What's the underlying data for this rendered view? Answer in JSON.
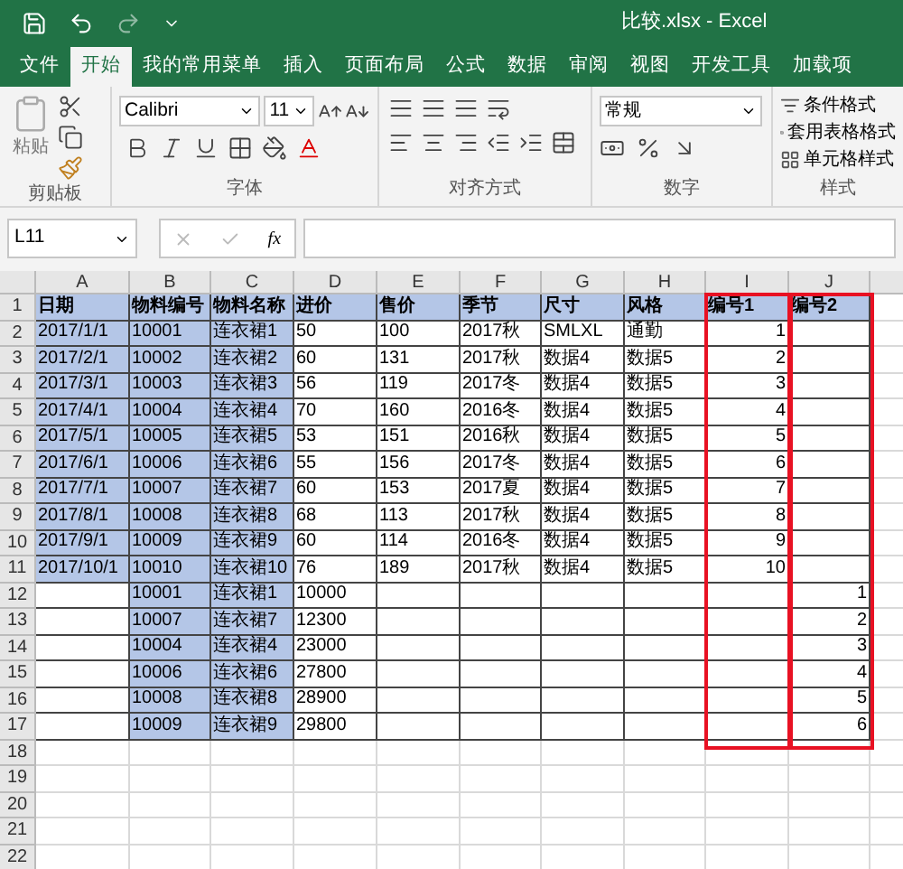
{
  "window": {
    "title": "比较.xlsx  -  Excel"
  },
  "tabs": [
    {
      "label": "文件",
      "selected": false
    },
    {
      "label": "开始",
      "selected": true
    },
    {
      "label": "我的常用菜单",
      "selected": false
    },
    {
      "label": "插入",
      "selected": false
    },
    {
      "label": "页面布局",
      "selected": false
    },
    {
      "label": "公式",
      "selected": false
    },
    {
      "label": "数据",
      "selected": false
    },
    {
      "label": "审阅",
      "selected": false
    },
    {
      "label": "视图",
      "selected": false
    },
    {
      "label": "开发工具",
      "selected": false
    },
    {
      "label": "加载项",
      "selected": false
    }
  ],
  "ribbon": {
    "paste_label": "粘贴",
    "font_name": "Calibri",
    "font_size": "11",
    "number_format": "常规",
    "styles": [
      "条件格式",
      "套用表格格式",
      "单元格样式"
    ],
    "groups": [
      "剪贴板",
      "字体",
      "对齐方式",
      "数字",
      "样式"
    ]
  },
  "formula_bar": {
    "name_box": "L11",
    "fx": "fx"
  },
  "columns": [
    {
      "label": "A",
      "framed": false
    },
    {
      "label": "B",
      "framed": false
    },
    {
      "label": "C",
      "framed": false
    },
    {
      "label": "D",
      "framed": false
    },
    {
      "label": "E",
      "framed": false
    },
    {
      "label": "F",
      "framed": false
    },
    {
      "label": "G",
      "framed": false
    },
    {
      "label": "H",
      "framed": false
    },
    {
      "label": "I",
      "framed": true
    },
    {
      "label": "J",
      "framed": true
    }
  ],
  "rows": [
    {
      "number": "1",
      "bold": true,
      "cells": [
        {
          "text": "日期",
          "highlighted": true
        },
        {
          "text": "物料编号",
          "highlighted": true
        },
        {
          "text": "物料名称",
          "highlighted": true
        },
        {
          "text": "进价",
          "highlighted": true
        },
        {
          "text": "售价",
          "highlighted": true
        },
        {
          "text": "季节",
          "highlighted": true
        },
        {
          "text": "尺寸",
          "highlighted": true
        },
        {
          "text": "风格",
          "highlighted": true
        },
        {
          "text": "编号1",
          "highlighted": true
        },
        {
          "text": "编号2",
          "highlighted": true
        }
      ]
    },
    {
      "number": "2",
      "bold": false,
      "cells": [
        {
          "text": "2017/1/1",
          "highlighted": true
        },
        {
          "text": "10001",
          "highlighted": true
        },
        {
          "text": "连衣裙1",
          "highlighted": true
        },
        {
          "text": "50",
          "highlighted": false
        },
        {
          "text": "100",
          "highlighted": false
        },
        {
          "text": "2017秋",
          "highlighted": false
        },
        {
          "text": "SMLXL",
          "highlighted": false
        },
        {
          "text": "通勤",
          "highlighted": false
        },
        {
          "text": "1",
          "highlighted": false,
          "kind": "number"
        },
        {
          "highlighted": false
        }
      ]
    },
    {
      "number": "3",
      "bold": false,
      "cells": [
        {
          "text": "2017/2/1",
          "highlighted": true
        },
        {
          "text": "10002",
          "highlighted": true
        },
        {
          "text": "连衣裙2",
          "highlighted": true
        },
        {
          "text": "60",
          "highlighted": false
        },
        {
          "text": "131",
          "highlighted": false
        },
        {
          "text": "2017秋",
          "highlighted": false
        },
        {
          "text": "数据4",
          "highlighted": false
        },
        {
          "text": "数据5",
          "highlighted": false
        },
        {
          "text": "2",
          "highlighted": false,
          "kind": "number"
        },
        {
          "highlighted": false
        }
      ]
    },
    {
      "number": "4",
      "bold": false,
      "cells": [
        {
          "text": "2017/3/1",
          "highlighted": true
        },
        {
          "text": "10003",
          "highlighted": true
        },
        {
          "text": "连衣裙3",
          "highlighted": true
        },
        {
          "text": "56",
          "highlighted": false
        },
        {
          "text": "119",
          "highlighted": false
        },
        {
          "text": "2017冬",
          "highlighted": false
        },
        {
          "text": "数据4",
          "highlighted": false
        },
        {
          "text": "数据5",
          "highlighted": false
        },
        {
          "text": "3",
          "highlighted": false,
          "kind": "number"
        },
        {
          "highlighted": false
        }
      ]
    },
    {
      "number": "5",
      "bold": false,
      "cells": [
        {
          "text": "2017/4/1",
          "highlighted": true
        },
        {
          "text": "10004",
          "highlighted": true
        },
        {
          "text": "连衣裙4",
          "highlighted": true
        },
        {
          "text": "70",
          "highlighted": false
        },
        {
          "text": "160",
          "highlighted": false
        },
        {
          "text": "2016冬",
          "highlighted": false
        },
        {
          "text": "数据4",
          "highlighted": false
        },
        {
          "text": "数据5",
          "highlighted": false
        },
        {
          "text": "4",
          "highlighted": false,
          "kind": "number"
        },
        {
          "highlighted": false
        }
      ]
    },
    {
      "number": "6",
      "bold": false,
      "cells": [
        {
          "text": "2017/5/1",
          "highlighted": true
        },
        {
          "text": "10005",
          "highlighted": true
        },
        {
          "text": "连衣裙5",
          "highlighted": true
        },
        {
          "text": "53",
          "highlighted": false
        },
        {
          "text": "151",
          "highlighted": false
        },
        {
          "text": "2016秋",
          "highlighted": false
        },
        {
          "text": "数据4",
          "highlighted": false
        },
        {
          "text": "数据5",
          "highlighted": false
        },
        {
          "text": "5",
          "highlighted": false,
          "kind": "number"
        },
        {
          "highlighted": false
        }
      ]
    },
    {
      "number": "7",
      "bold": false,
      "cells": [
        {
          "text": "2017/6/1",
          "highlighted": true
        },
        {
          "text": "10006",
          "highlighted": true
        },
        {
          "text": "连衣裙6",
          "highlighted": true
        },
        {
          "text": "55",
          "highlighted": false
        },
        {
          "text": "156",
          "highlighted": false
        },
        {
          "text": "2017冬",
          "highlighted": false
        },
        {
          "text": "数据4",
          "highlighted": false
        },
        {
          "text": "数据5",
          "highlighted": false
        },
        {
          "text": "6",
          "highlighted": false,
          "kind": "number"
        },
        {
          "highlighted": false
        }
      ]
    },
    {
      "number": "8",
      "bold": false,
      "cells": [
        {
          "text": "2017/7/1",
          "highlighted": true
        },
        {
          "text": "10007",
          "highlighted": true
        },
        {
          "text": "连衣裙7",
          "highlighted": true
        },
        {
          "text": "60",
          "highlighted": false
        },
        {
          "text": "153",
          "highlighted": false
        },
        {
          "text": "2017夏",
          "highlighted": false
        },
        {
          "text": "数据4",
          "highlighted": false
        },
        {
          "text": "数据5",
          "highlighted": false
        },
        {
          "text": "7",
          "highlighted": false,
          "kind": "number"
        },
        {
          "highlighted": false
        }
      ]
    },
    {
      "number": "9",
      "bold": false,
      "cells": [
        {
          "text": "2017/8/1",
          "highlighted": true
        },
        {
          "text": "10008",
          "highlighted": true
        },
        {
          "text": "连衣裙8",
          "highlighted": true
        },
        {
          "text": "68",
          "highlighted": false
        },
        {
          "text": "113",
          "highlighted": false
        },
        {
          "text": "2017秋",
          "highlighted": false
        },
        {
          "text": "数据4",
          "highlighted": false
        },
        {
          "text": "数据5",
          "highlighted": false
        },
        {
          "text": "8",
          "highlighted": false,
          "kind": "number"
        },
        {
          "highlighted": false
        }
      ]
    },
    {
      "number": "10",
      "bold": false,
      "cells": [
        {
          "text": "2017/9/1",
          "highlighted": true
        },
        {
          "text": "10009",
          "highlighted": true
        },
        {
          "text": "连衣裙9",
          "highlighted": true
        },
        {
          "text": "60",
          "highlighted": false
        },
        {
          "text": "114",
          "highlighted": false
        },
        {
          "text": "2016冬",
          "highlighted": false
        },
        {
          "text": "数据4",
          "highlighted": false
        },
        {
          "text": "数据5",
          "highlighted": false
        },
        {
          "text": "9",
          "highlighted": false,
          "kind": "number"
        },
        {
          "highlighted": false
        }
      ]
    },
    {
      "number": "11",
      "bold": false,
      "cells": [
        {
          "text": "2017/10/1",
          "highlighted": true
        },
        {
          "text": "10010",
          "highlighted": true
        },
        {
          "text": "连衣裙10",
          "highlighted": true
        },
        {
          "text": "76",
          "highlighted": false
        },
        {
          "text": "189",
          "highlighted": false
        },
        {
          "text": "2017秋",
          "highlighted": false
        },
        {
          "text": "数据4",
          "highlighted": false
        },
        {
          "text": "数据5",
          "highlighted": false
        },
        {
          "text": "10",
          "highlighted": false,
          "kind": "number"
        },
        {
          "highlighted": false
        }
      ]
    },
    {
      "number": "12",
      "bold": false,
      "cells": [
        {
          "highlighted": false
        },
        {
          "text": "10001",
          "highlighted": true
        },
        {
          "text": "连衣裙1",
          "highlighted": true
        },
        {
          "text": "10000",
          "highlighted": false
        },
        {
          "highlighted": false
        },
        {
          "highlighted": false
        },
        {
          "highlighted": false
        },
        {
          "highlighted": false
        },
        {
          "highlighted": false
        },
        {
          "text": "1",
          "highlighted": false,
          "kind": "number"
        }
      ]
    },
    {
      "number": "13",
      "bold": false,
      "cells": [
        {
          "highlighted": false
        },
        {
          "text": "10007",
          "highlighted": true
        },
        {
          "text": "连衣裙7",
          "highlighted": true
        },
        {
          "text": "12300",
          "highlighted": false
        },
        {
          "highlighted": false
        },
        {
          "highlighted": false
        },
        {
          "highlighted": false
        },
        {
          "highlighted": false
        },
        {
          "highlighted": false
        },
        {
          "text": "2",
          "highlighted": false,
          "kind": "number"
        }
      ]
    },
    {
      "number": "14",
      "bold": false,
      "cells": [
        {
          "highlighted": false
        },
        {
          "text": "10004",
          "highlighted": true
        },
        {
          "text": "连衣裙4",
          "highlighted": true
        },
        {
          "text": "23000",
          "highlighted": false
        },
        {
          "highlighted": false
        },
        {
          "highlighted": false
        },
        {
          "highlighted": false
        },
        {
          "highlighted": false
        },
        {
          "highlighted": false
        },
        {
          "text": "3",
          "highlighted": false,
          "kind": "number"
        }
      ]
    },
    {
      "number": "15",
      "bold": false,
      "cells": [
        {
          "highlighted": false
        },
        {
          "text": "10006",
          "highlighted": true
        },
        {
          "text": "连衣裙6",
          "highlighted": true
        },
        {
          "text": "27800",
          "highlighted": false
        },
        {
          "highlighted": false
        },
        {
          "highlighted": false
        },
        {
          "highlighted": false
        },
        {
          "highlighted": false
        },
        {
          "highlighted": false
        },
        {
          "text": "4",
          "highlighted": false,
          "kind": "number"
        }
      ]
    },
    {
      "number": "16",
      "bold": false,
      "cells": [
        {
          "highlighted": false
        },
        {
          "text": "10008",
          "highlighted": true
        },
        {
          "text": "连衣裙8",
          "highlighted": true
        },
        {
          "text": "28900",
          "highlighted": false
        },
        {
          "highlighted": false
        },
        {
          "highlighted": false
        },
        {
          "highlighted": false
        },
        {
          "highlighted": false
        },
        {
          "highlighted": false
        },
        {
          "text": "5",
          "highlighted": false,
          "kind": "number"
        }
      ]
    },
    {
      "number": "17",
      "bold": false,
      "cells": [
        {
          "highlighted": false
        },
        {
          "text": "10009",
          "highlighted": true
        },
        {
          "text": "连衣裙9",
          "highlighted": true
        },
        {
          "text": "29800",
          "highlighted": false
        },
        {
          "highlighted": false
        },
        {
          "highlighted": false
        },
        {
          "highlighted": false
        },
        {
          "highlighted": false
        },
        {
          "highlighted": false
        },
        {
          "text": "6",
          "highlighted": false,
          "kind": "number"
        }
      ]
    },
    {
      "number": "18"
    },
    {
      "number": "19"
    },
    {
      "number": "20"
    },
    {
      "number": "21"
    },
    {
      "number": "22"
    }
  ]
}
